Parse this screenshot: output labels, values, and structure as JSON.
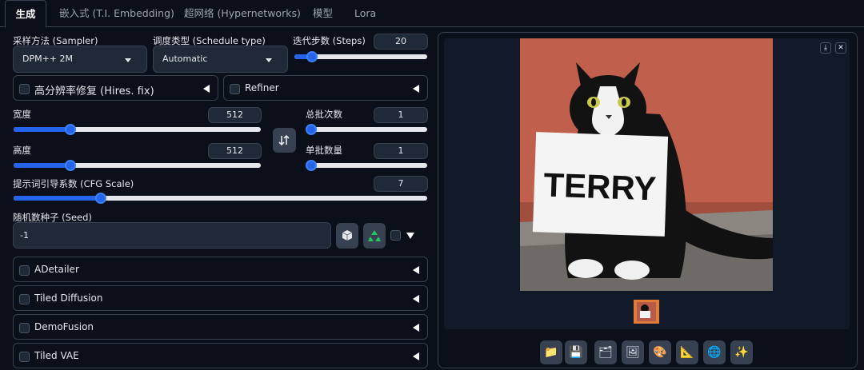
{
  "tabs": [
    {
      "label": "生成",
      "active": true
    },
    {
      "label": "嵌入式 (T.I. Embedding)",
      "active": false
    },
    {
      "label": "超网络 (Hypernetworks)",
      "active": false
    },
    {
      "label": "模型",
      "active": false
    },
    {
      "label": "Lora",
      "active": false
    }
  ],
  "sampler": {
    "label": "采样方法 (Sampler)",
    "value": "DPM++ 2M"
  },
  "schedule": {
    "label": "调度类型 (Schedule type)",
    "value": "Automatic"
  },
  "steps": {
    "label": "迭代步数 (Steps)",
    "value": "20",
    "level": 0.13
  },
  "hires": {
    "label": "高分辨率修复 (Hires. fix)"
  },
  "refiner": {
    "label": "Refiner"
  },
  "width": {
    "label": "宽度",
    "value": "512",
    "level": 0.23
  },
  "height": {
    "label": "高度",
    "value": "512",
    "level": 0.23
  },
  "batch_count": {
    "label": "总批次数",
    "value": "1",
    "level": 0.0
  },
  "batch_size": {
    "label": "单批数量",
    "value": "1",
    "level": 0.0
  },
  "cfg": {
    "label": "提示词引导系数 (CFG Scale)",
    "value": "7",
    "level": 0.21
  },
  "seed": {
    "label": "随机数种子 (Seed)",
    "value": "-1"
  },
  "extensions": [
    {
      "label": "ADetailer"
    },
    {
      "label": "Tiled Diffusion"
    },
    {
      "label": "DemoFusion"
    },
    {
      "label": "Tiled VAE"
    }
  ],
  "image": {
    "sign_text": "TERRY"
  },
  "icons": {
    "swap": "swap-dimensions-icon",
    "dice": "dice-icon",
    "recycle": "recycle-icon",
    "toolbar": [
      "folder-icon",
      "save-icon",
      "zip-icon",
      "image-icon",
      "palette-icon",
      "ruler-icon",
      "globe-icon",
      "sparkle-icon"
    ]
  },
  "colors": {
    "accent": "#2563eb",
    "background": "#0b0f19",
    "panel": "#1f2937",
    "recycle_green": "#22c55e"
  }
}
